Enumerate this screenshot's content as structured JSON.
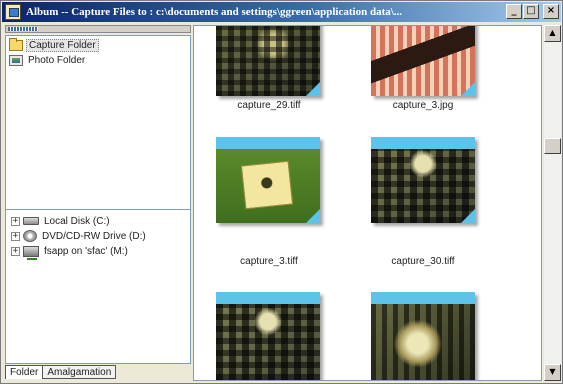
{
  "window": {
    "title": "Album -- Capture Files to : c:\\documents and settings\\ggreen\\application data\\...",
    "controls": {
      "minimize": "_",
      "maximize": "□",
      "close": "×"
    }
  },
  "folders": {
    "items": [
      {
        "label": "Capture Folder",
        "icon": "capture-folder-icon",
        "selected": true
      },
      {
        "label": "Photo Folder",
        "icon": "photo-folder-icon",
        "selected": false
      }
    ]
  },
  "drives": {
    "items": [
      {
        "label": "Local Disk (C:)",
        "icon": "hard-disk-icon",
        "expander": "+"
      },
      {
        "label": "DVD/CD-RW Drive (D:)",
        "icon": "cd-drive-icon",
        "expander": "+"
      },
      {
        "label": "fsapp on 'sfac' (M:)",
        "icon": "network-drive-icon",
        "expander": "+"
      }
    ]
  },
  "tabs": [
    {
      "label": "Folder",
      "active": true
    },
    {
      "label": "Amalgamation",
      "active": false
    }
  ],
  "thumbnails": [
    {
      "filename": "capture_29.tiff"
    },
    {
      "filename": "capture_3.jpg"
    },
    {
      "filename": "capture_3.tiff"
    },
    {
      "filename": "capture_30.tiff"
    },
    {
      "filename": ""
    },
    {
      "filename": ""
    }
  ],
  "scrollbar": {
    "up_arrow": "▲",
    "down_arrow": "▼"
  },
  "colors": {
    "titlebar_start": "#0a246a",
    "titlebar_end": "#a6caf0",
    "thumbnail_accent": "#5cc3ea"
  }
}
